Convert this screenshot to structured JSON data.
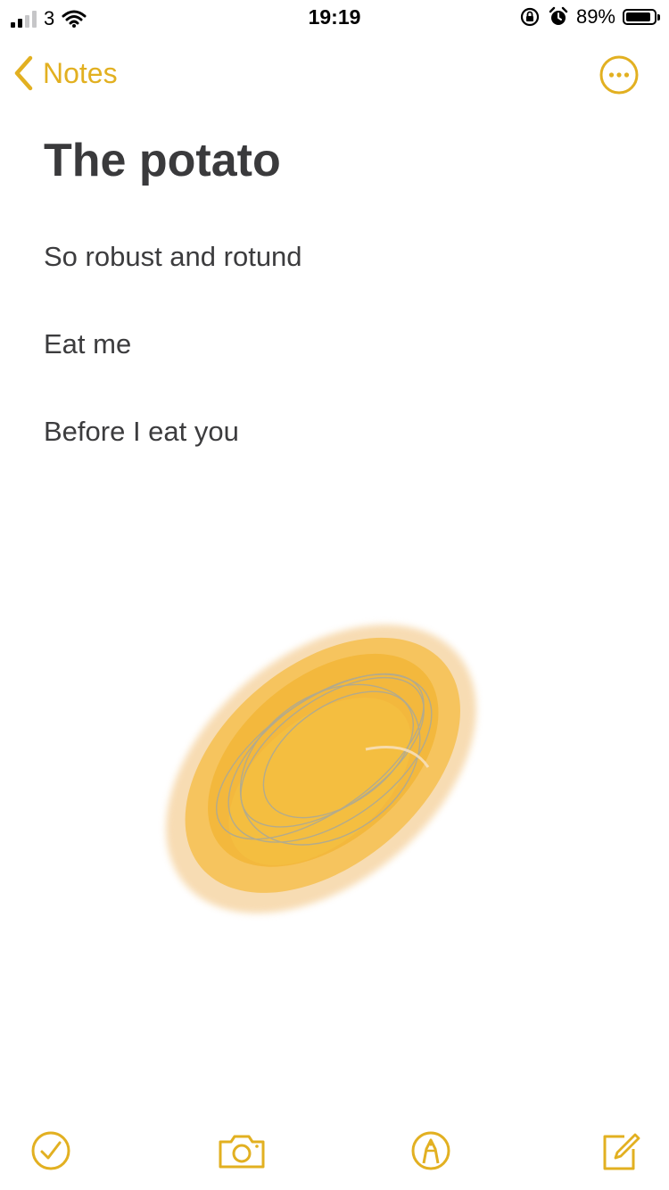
{
  "status_bar": {
    "carrier": "3",
    "time": "19:19",
    "battery_percent_label": "89%",
    "battery_level": 0.89
  },
  "nav": {
    "back_label": "Notes"
  },
  "note": {
    "title": "The potato",
    "lines": [
      "So robust and rotund",
      "Eat me",
      "Before I eat you"
    ]
  },
  "colors": {
    "accent": "#e2b021",
    "text": "#3c3c3e",
    "drawing_fill": "#f3b73a",
    "drawing_halo": "#f6d6a6"
  },
  "icons": {
    "back": "chevron-left-icon",
    "more": "ellipsis-circle-icon",
    "checklist": "checkmark-circle-icon",
    "camera": "camera-icon",
    "markup": "pen-tip-circle-icon",
    "compose": "compose-icon"
  }
}
